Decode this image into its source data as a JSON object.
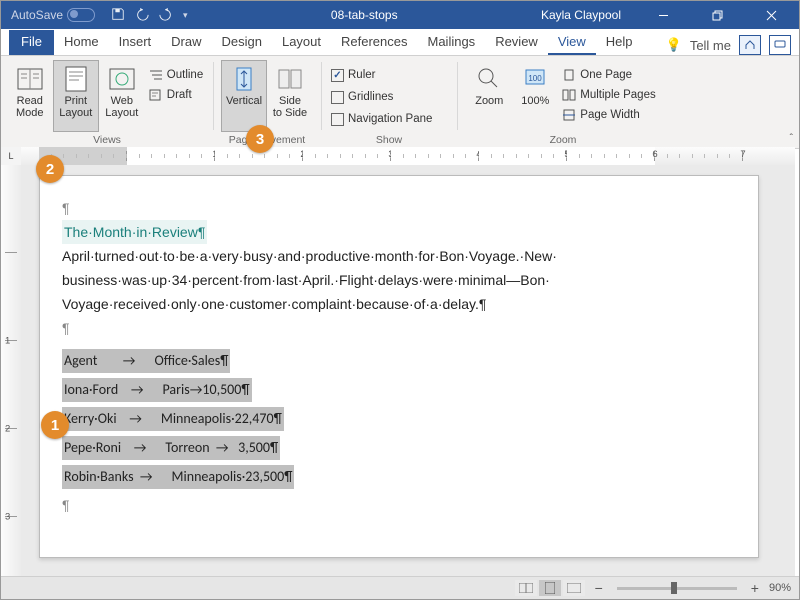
{
  "title": {
    "autosave": "AutoSave",
    "doc": "08-tab-stops",
    "user": "Kayla Claypool"
  },
  "tabs": {
    "items": [
      "File",
      "Home",
      "Insert",
      "Draw",
      "Design",
      "Layout",
      "References",
      "Mailings",
      "Review",
      "View",
      "Help"
    ],
    "tell_me": "Tell me"
  },
  "ribbon": {
    "views": {
      "label": "Views",
      "read_mode": "Read\nMode",
      "print_layout": "Print\nLayout",
      "web_layout": "Web\nLayout",
      "outline": "Outline",
      "draft": "Draft"
    },
    "movement": {
      "label": "Page Movement",
      "vertical": "Vertical",
      "side": "Side\nto Side"
    },
    "show": {
      "label": "Show",
      "ruler": "Ruler",
      "gridlines": "Gridlines",
      "nav": "Navigation Pane"
    },
    "zoom": {
      "label": "Zoom",
      "zoom": "Zoom",
      "hundred": "100%",
      "one_page": "One Page",
      "multi": "Multiple Pages",
      "width": "Page Width"
    }
  },
  "document": {
    "heading": "The·Month·in·Review¶",
    "body1": "April·turned·out·to·be·a·very·busy·and·productive·month·for·Bon·Voyage.·New·",
    "body2": "business·was·up·34·percent·from·last·April.·Flight·delays·were·minimal—Bon·",
    "body3": "Voyage·received·only·one·customer·complaint·because·of·a·delay.¶",
    "rows": [
      "Agent        →      Office·Sales¶",
      "Iona·Ford    →      Paris→10,500¶",
      "Kerry·Oki    →      Minneapolis·22,470¶",
      "Pepe·Roni    →      Torreon  →   3,500¶",
      "Robin·Banks  →      Minneapolis·23,500¶"
    ]
  },
  "status": {
    "zoom_minus": "−",
    "zoom_plus": "+",
    "zoom_pct": "90%"
  },
  "ruler_h": [
    "1",
    "2",
    "3",
    "4",
    "5",
    "6",
    "7"
  ],
  "callouts": {
    "c1": "1",
    "c2": "2",
    "c3": "3"
  }
}
